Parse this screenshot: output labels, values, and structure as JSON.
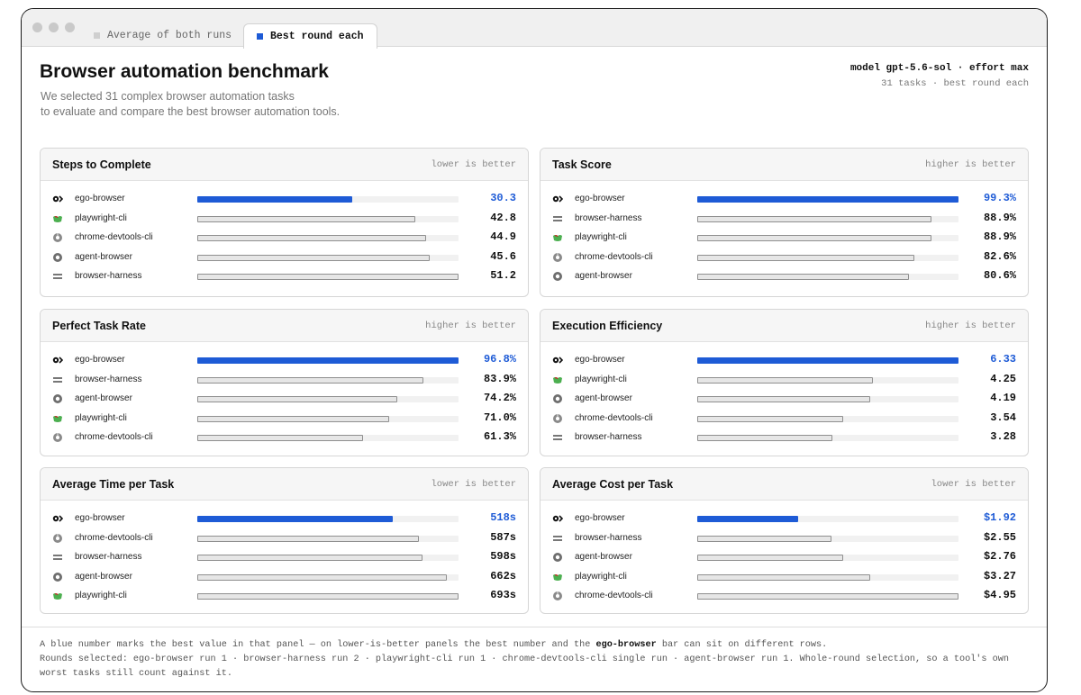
{
  "window": {
    "tabs": [
      {
        "label": "Average of both runs",
        "active": false
      },
      {
        "label": "Best round each",
        "active": true
      }
    ]
  },
  "header": {
    "title": "Browser automation benchmark",
    "subtitle_line1": "We selected 31 complex browser automation tasks",
    "subtitle_line2": "to evaluate and compare the best browser automation tools.",
    "meta_line1": "model gpt-5.6-sol · effort max",
    "meta_line2": "31 tasks · best round each"
  },
  "colors": {
    "accent": "#1e5bd6",
    "bar_fill": "#e6e6e6",
    "bar_border": "#8f8f8f"
  },
  "tool_icons": {
    "ego-browser": "ego-browser-icon",
    "playwright-cli": "playwright-icon",
    "chrome-devtools-cli": "chrome-devtools-icon",
    "agent-browser": "agent-browser-icon",
    "browser-harness": "browser-harness-icon"
  },
  "panels": [
    {
      "title": "Steps to Complete",
      "hint": "lower is better",
      "rows": [
        {
          "tool": "ego-browser",
          "value": 30.3,
          "display": "30.3",
          "best": true
        },
        {
          "tool": "playwright-cli",
          "value": 42.8,
          "display": "42.8",
          "best": false
        },
        {
          "tool": "chrome-devtools-cli",
          "value": 44.9,
          "display": "44.9",
          "best": false
        },
        {
          "tool": "agent-browser",
          "value": 45.6,
          "display": "45.6",
          "best": false
        },
        {
          "tool": "browser-harness",
          "value": 51.2,
          "display": "51.2",
          "best": false
        }
      ]
    },
    {
      "title": "Task Score",
      "hint": "higher is better",
      "rows": [
        {
          "tool": "ego-browser",
          "value": 99.3,
          "display": "99.3%",
          "best": true
        },
        {
          "tool": "browser-harness",
          "value": 88.9,
          "display": "88.9%",
          "best": false
        },
        {
          "tool": "playwright-cli",
          "value": 88.9,
          "display": "88.9%",
          "best": false
        },
        {
          "tool": "chrome-devtools-cli",
          "value": 82.6,
          "display": "82.6%",
          "best": false
        },
        {
          "tool": "agent-browser",
          "value": 80.6,
          "display": "80.6%",
          "best": false
        }
      ]
    },
    {
      "title": "Perfect Task Rate",
      "hint": "higher is better",
      "rows": [
        {
          "tool": "ego-browser",
          "value": 96.8,
          "display": "96.8%",
          "best": true
        },
        {
          "tool": "browser-harness",
          "value": 83.9,
          "display": "83.9%",
          "best": false
        },
        {
          "tool": "agent-browser",
          "value": 74.2,
          "display": "74.2%",
          "best": false
        },
        {
          "tool": "playwright-cli",
          "value": 71.0,
          "display": "71.0%",
          "best": false
        },
        {
          "tool": "chrome-devtools-cli",
          "value": 61.3,
          "display": "61.3%",
          "best": false
        }
      ]
    },
    {
      "title": "Execution Efficiency",
      "hint": "higher is better",
      "rows": [
        {
          "tool": "ego-browser",
          "value": 6.33,
          "display": "6.33",
          "best": true
        },
        {
          "tool": "playwright-cli",
          "value": 4.25,
          "display": "4.25",
          "best": false
        },
        {
          "tool": "agent-browser",
          "value": 4.19,
          "display": "4.19",
          "best": false
        },
        {
          "tool": "chrome-devtools-cli",
          "value": 3.54,
          "display": "3.54",
          "best": false
        },
        {
          "tool": "browser-harness",
          "value": 3.28,
          "display": "3.28",
          "best": false
        }
      ]
    },
    {
      "title": "Average Time per Task",
      "hint": "lower is better",
      "rows": [
        {
          "tool": "ego-browser",
          "value": 518,
          "display": "518s",
          "best": true
        },
        {
          "tool": "chrome-devtools-cli",
          "value": 587,
          "display": "587s",
          "best": false
        },
        {
          "tool": "browser-harness",
          "value": 598,
          "display": "598s",
          "best": false
        },
        {
          "tool": "agent-browser",
          "value": 662,
          "display": "662s",
          "best": false
        },
        {
          "tool": "playwright-cli",
          "value": 693,
          "display": "693s",
          "best": false
        }
      ]
    },
    {
      "title": "Average Cost per Task",
      "hint": "lower is better",
      "rows": [
        {
          "tool": "ego-browser",
          "value": 1.92,
          "display": "$1.92",
          "best": true
        },
        {
          "tool": "browser-harness",
          "value": 2.55,
          "display": "$2.55",
          "best": false
        },
        {
          "tool": "agent-browser",
          "value": 2.76,
          "display": "$2.76",
          "best": false
        },
        {
          "tool": "playwright-cli",
          "value": 3.27,
          "display": "$3.27",
          "best": false
        },
        {
          "tool": "chrome-devtools-cli",
          "value": 4.95,
          "display": "$4.95",
          "best": false
        }
      ]
    }
  ],
  "footer": {
    "line1_before": "A blue number marks the best value in that panel — on lower-is-better panels the best number and the ",
    "line1_bold": "ego-browser",
    "line1_after": " bar can sit on different rows.",
    "line2": "Rounds selected: ego-browser run 1 · browser-harness run 2 · playwright-cli run 1 · chrome-devtools-cli single run · agent-browser run 1. Whole-round selection, so a tool's own worst tasks still count against it."
  }
}
